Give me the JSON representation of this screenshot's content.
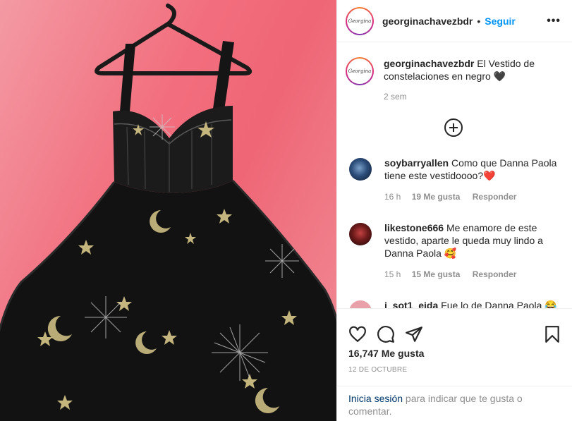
{
  "post": {
    "username": "georginachavezbdr",
    "follow_label": "Seguir",
    "separator": "•",
    "more_label": "•••",
    "avatar_logo": "Georgina"
  },
  "caption": {
    "username": "georginachavezbdr",
    "text": "El Vestido de constelaciones en negro 🖤",
    "time": "2 sem"
  },
  "comments": [
    {
      "username": "soybarryallen",
      "text": "Como que Danna Paola tiene este vestidoooo?❤️",
      "time": "16 h",
      "likes": "19 Me gusta",
      "reply": "Responder"
    },
    {
      "username": "likestone666",
      "text": "Me enamore de este vestido, aparte le queda muy lindo a Danna Paola 🥰",
      "time": "15 h",
      "likes": "15 Me gusta",
      "reply": "Responder"
    },
    {
      "username": "i_sot1_eida",
      "text": "Fue lo de Danna Paola 😂",
      "time": "",
      "likes": "",
      "reply": ""
    }
  ],
  "actions": {
    "like_icon": "heart-icon",
    "comment_icon": "comment-icon",
    "share_icon": "send-icon",
    "save_icon": "bookmark-icon"
  },
  "likes_count": "16,747 Me gusta",
  "date": "12 de octubre",
  "login_bar": {
    "link": "Inicia sesión",
    "text": " para indicar que te gusta o comentar."
  },
  "colors": {
    "accent": "#0095f6",
    "photo_background": "#f07080",
    "dress": "#111111"
  }
}
